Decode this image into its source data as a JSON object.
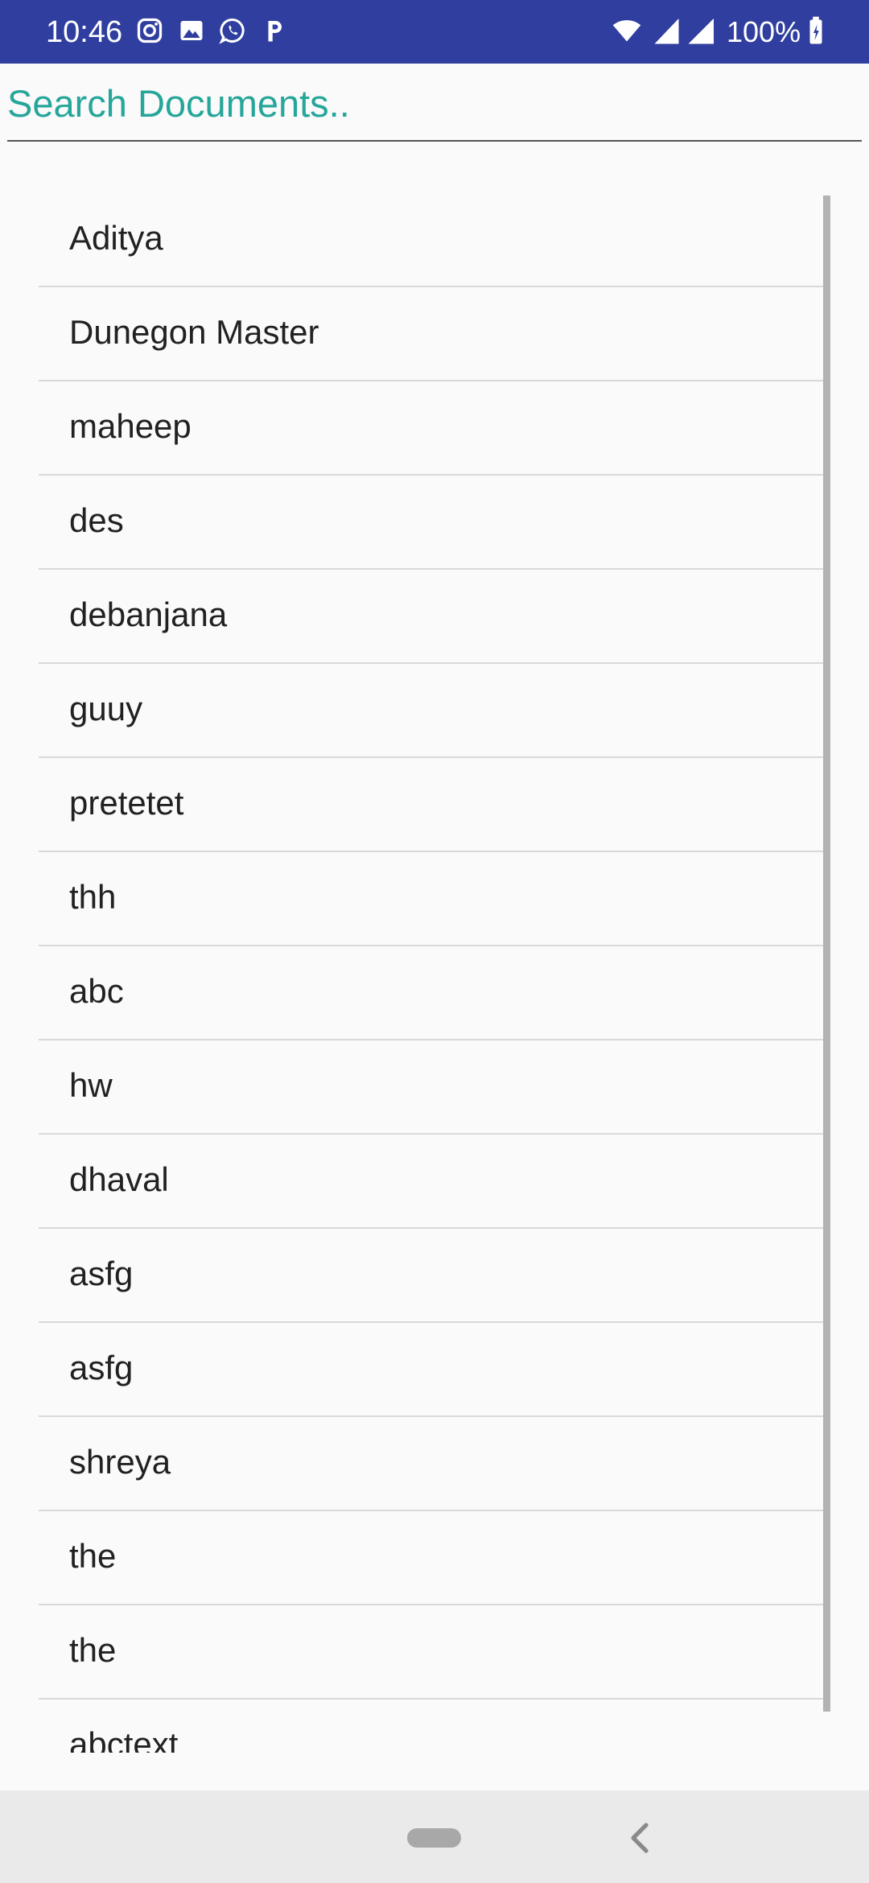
{
  "status_bar": {
    "time": "10:46",
    "battery": "100%",
    "notification_icons": [
      "instagram-icon",
      "gallery-icon",
      "whatsapp-icon",
      "paytm-icon"
    ],
    "system_icons": [
      "wifi-icon",
      "signal-icon",
      "battery-icon"
    ],
    "background_color": "#303f9f"
  },
  "search": {
    "placeholder": "Search Documents..",
    "value": "",
    "accent_color": "#26a69a"
  },
  "documents": [
    "Aditya",
    "Dunegon Master",
    "maheep",
    "des",
    "debanjana",
    "guuy",
    "pretetet",
    "thh",
    "abc",
    "hw",
    "dhaval",
    "asfg",
    "asfg",
    "shreya",
    "the",
    "the",
    "abctext"
  ],
  "navigation": {
    "icons": [
      "home-pill-icon",
      "back-icon"
    ]
  }
}
